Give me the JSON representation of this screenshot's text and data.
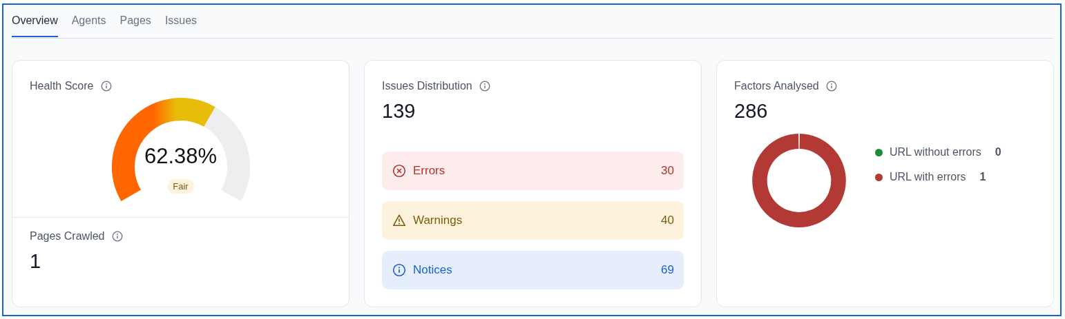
{
  "tabs": [
    {
      "label": "Overview",
      "selected": true
    },
    {
      "label": "Agents",
      "selected": false
    },
    {
      "label": "Pages",
      "selected": false
    },
    {
      "label": "Issues",
      "selected": false
    }
  ],
  "health_score": {
    "title": "Health Score",
    "value": "62.38%",
    "rating": "Fair"
  },
  "pages_crawled": {
    "title": "Pages Crawled",
    "value": "1"
  },
  "issues_distribution": {
    "title": "Issues Distribution",
    "total": "139",
    "rows": [
      {
        "kind": "error",
        "label": "Errors",
        "count": "30"
      },
      {
        "kind": "warning",
        "label": "Warnings",
        "count": "40"
      },
      {
        "kind": "notice",
        "label": "Notices",
        "count": "69"
      }
    ]
  },
  "factors_analysed": {
    "title": "Factors Analysed",
    "total": "286",
    "legend": [
      {
        "label": "URL without errors",
        "value": "0",
        "color": "#1e8a3c"
      },
      {
        "label": "URL with errors",
        "value": "1",
        "color": "#b33a34"
      }
    ]
  }
}
